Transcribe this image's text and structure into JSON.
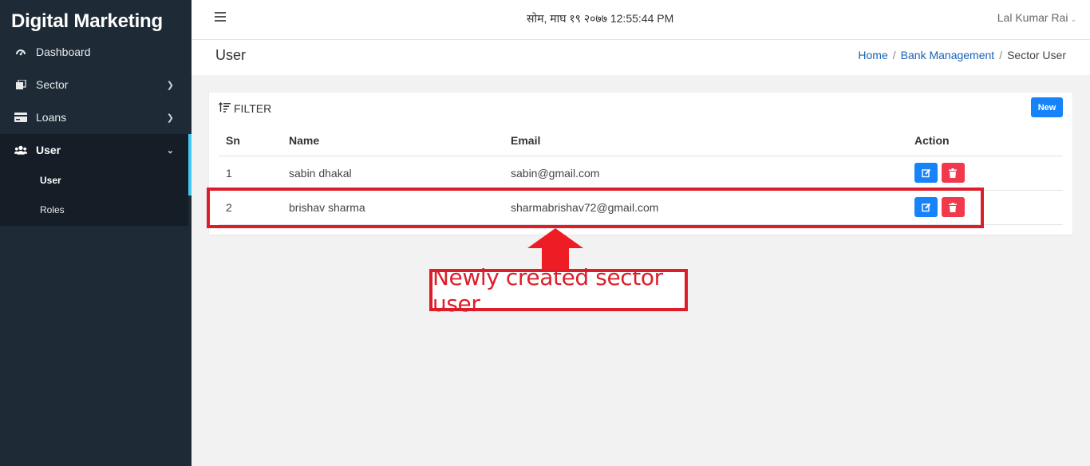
{
  "app": {
    "brand": "Digital Marketing"
  },
  "sidebar": {
    "items": [
      {
        "label": "Dashboard",
        "icon": "dashboard-icon"
      },
      {
        "label": "Sector",
        "icon": "sector-icon"
      },
      {
        "label": "Loans",
        "icon": "loans-icon"
      },
      {
        "label": "User",
        "icon": "users-icon"
      }
    ],
    "subitems": [
      {
        "label": "User"
      },
      {
        "label": "Roles"
      }
    ]
  },
  "topbar": {
    "datetime": "सोम, माघ १९ २०७७ 12:55:44 PM",
    "user": "Lal Kumar Rai"
  },
  "page": {
    "title": "User",
    "breadcrumb": [
      "Home",
      "Bank Management",
      "Sector User"
    ]
  },
  "card": {
    "filter_label": "FILTER",
    "new_button": "New",
    "columns": [
      "Sn",
      "Name",
      "Email",
      "Action"
    ],
    "rows": [
      {
        "sn": "1",
        "name": "sabin dhakal",
        "email": "sabin@gmail.com"
      },
      {
        "sn": "2",
        "name": "brishav sharma",
        "email": "sharmabrishav72@gmail.com"
      }
    ]
  },
  "annotation": {
    "text": "Newly created sector user",
    "color": "#dd1e2a"
  },
  "colors": {
    "primary": "#1683fb",
    "danger": "#f0394d",
    "sidebar": "#1e2a35",
    "accent": "#43c7f4"
  }
}
